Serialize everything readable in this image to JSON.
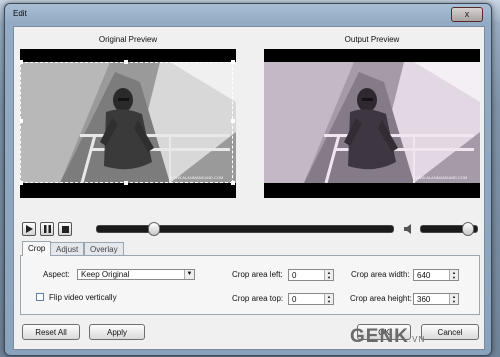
{
  "dialog": {
    "title": "Edit"
  },
  "preview": {
    "original_label": "Original Preview",
    "output_label": "Output Preview",
    "image_caption": "WWW.ALANMANDAND.COM"
  },
  "playback": {
    "play": "play",
    "pause": "pause",
    "stop": "stop",
    "seek_position": 0.18,
    "volume": 0.9
  },
  "tabs": [
    {
      "label": "Crop",
      "active": true
    },
    {
      "label": "Adjust",
      "active": false
    },
    {
      "label": "Overlay",
      "active": false
    }
  ],
  "crop": {
    "aspect_label": "Aspect:",
    "aspect_value": "Keep Original",
    "flip_label": "Flip video vertically",
    "flip_checked": false,
    "left_label": "Crop area left:",
    "left_value": "0",
    "top_label": "Crop area top:",
    "top_value": "0",
    "width_label": "Crop area width:",
    "width_value": "640",
    "height_label": "Crop area height:",
    "height_value": "360"
  },
  "buttons": {
    "reset_all": "Reset All",
    "apply": "Apply",
    "ok": "OK",
    "cancel": "Cancel",
    "close": "x"
  },
  "watermark": {
    "brand": "GENK",
    "suffix": ".VN"
  },
  "colors": {
    "dialog_frame": "#93abc4",
    "client_bg": "#f0f0f0",
    "preview_bg": "#000000"
  }
}
